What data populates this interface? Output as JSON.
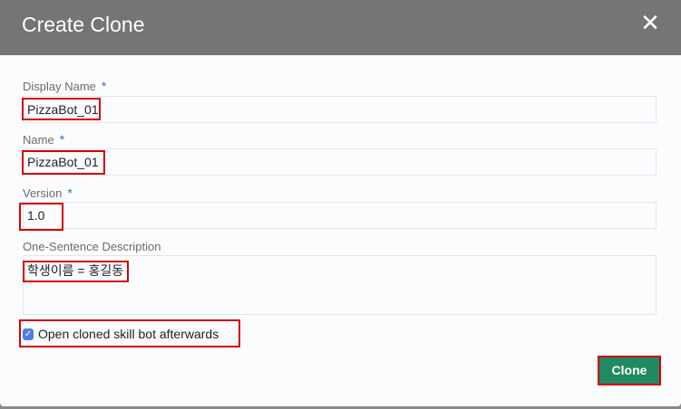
{
  "dialog": {
    "title": "Create Clone",
    "close_icon": "close-icon"
  },
  "fields": {
    "display_name": {
      "label": "Display Name",
      "required": "*",
      "value": "PizzaBot_01"
    },
    "name": {
      "label": "Name",
      "required": "*",
      "value": "PizzaBot_01"
    },
    "version": {
      "label": "Version",
      "required": "*",
      "value": "1.0"
    },
    "description": {
      "label": "One-Sentence Description",
      "value": "학생이름 = 홍길동"
    }
  },
  "checkbox": {
    "label": "Open cloned skill bot afterwards",
    "checked": true
  },
  "buttons": {
    "clone": "Clone"
  },
  "colors": {
    "header": "#737577",
    "accent": "#1f8a63",
    "highlight": "#d40000"
  }
}
